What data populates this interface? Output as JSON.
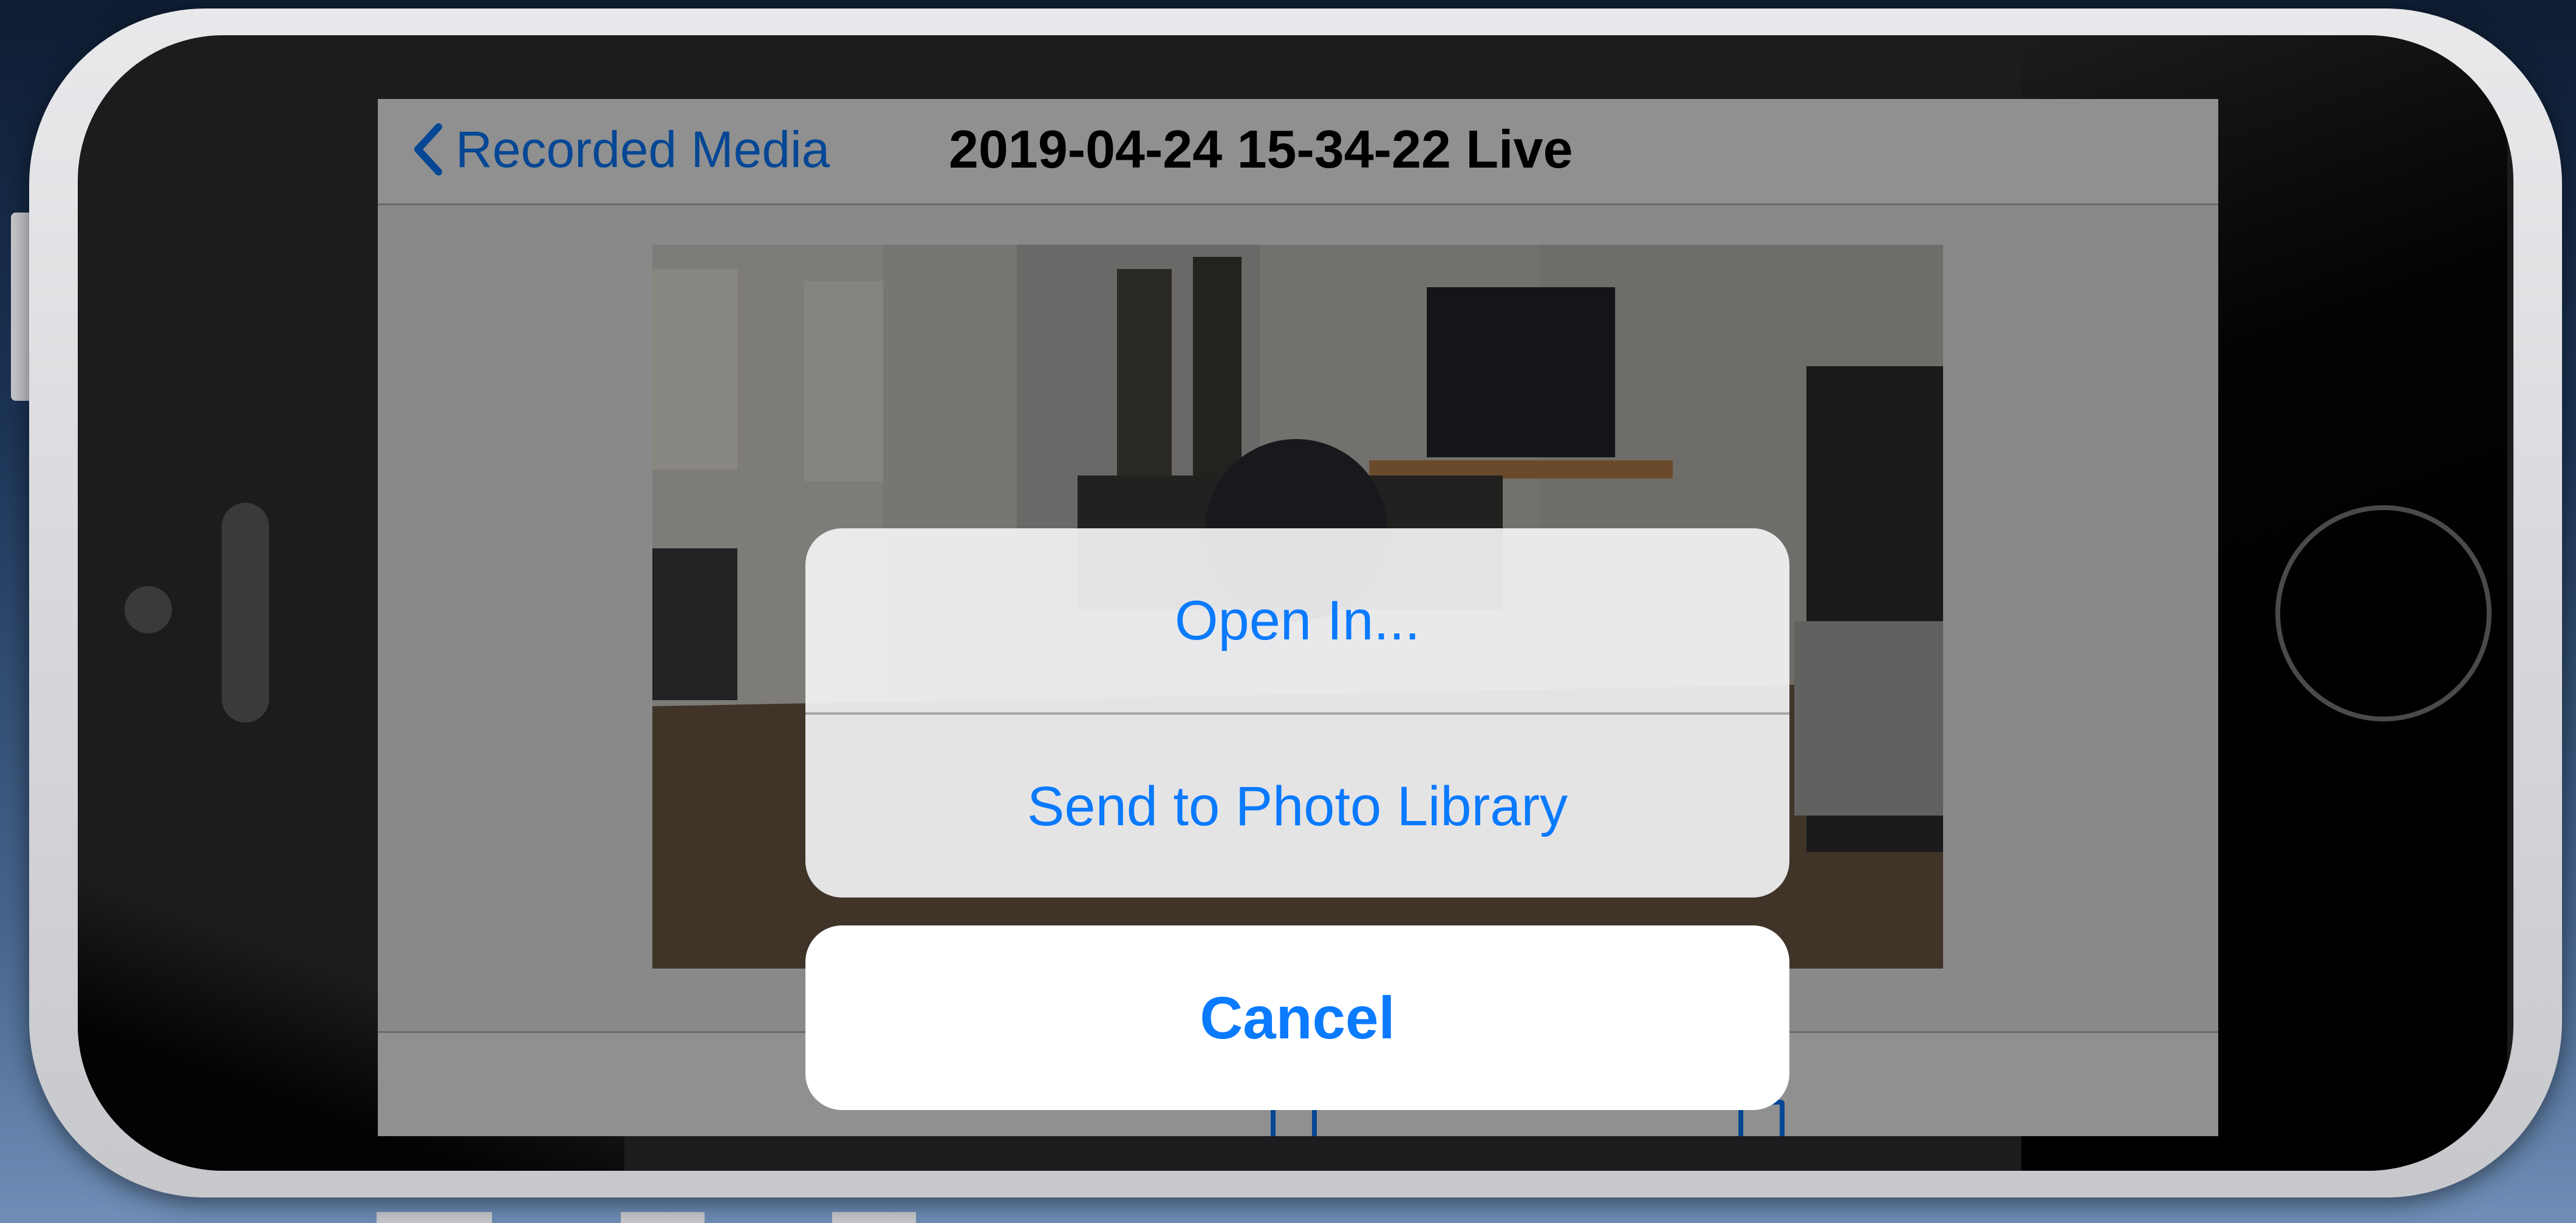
{
  "nav": {
    "back_label": "Recorded Media",
    "back_icon": "chevron-left-icon",
    "title": "2019-04-24 15-34-22 Live"
  },
  "action_sheet": {
    "items": [
      {
        "label": "Open In..."
      },
      {
        "label": "Send to Photo Library"
      }
    ],
    "cancel_label": "Cancel"
  },
  "colors": {
    "accent": "#0a7aff",
    "sheet_background": "#f2f2f4",
    "cancel_background": "#ffffff",
    "dim_overlay": "rgba(0,0,0,0.42)"
  }
}
